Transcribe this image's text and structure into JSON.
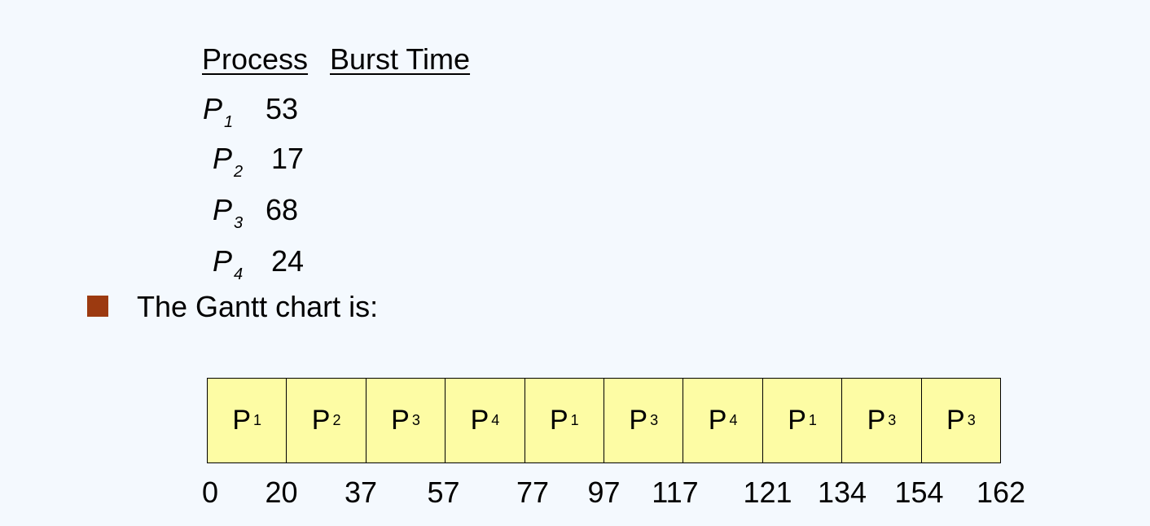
{
  "table": {
    "header_process": "Process",
    "header_burst": "Burst Time",
    "rows": [
      {
        "name": "P",
        "sub": "1",
        "burst": "53"
      },
      {
        "name": "P",
        "sub": "2",
        "burst": "17"
      },
      {
        "name": "P",
        "sub": "3",
        "burst": "68"
      },
      {
        "name": "P",
        "sub": "4",
        "burst": "24"
      }
    ]
  },
  "bullet": {
    "text": "The Gantt chart is:",
    "color": "#9c3a10"
  },
  "gantt": {
    "fill_color": "#fdfca4",
    "cells": [
      {
        "name": "P",
        "sub": "1"
      },
      {
        "name": "P",
        "sub": "2"
      },
      {
        "name": "P",
        "sub": "3"
      },
      {
        "name": "P",
        "sub": "4"
      },
      {
        "name": "P",
        "sub": "1"
      },
      {
        "name": "P",
        "sub": "3"
      },
      {
        "name": "P",
        "sub": "4"
      },
      {
        "name": "P",
        "sub": "1"
      },
      {
        "name": "P",
        "sub": "3"
      },
      {
        "name": "P",
        "sub": "3"
      }
    ],
    "ticks": [
      "0",
      "20",
      "37",
      "57",
      "77",
      "97",
      "117",
      "121",
      "134",
      "154",
      "162"
    ]
  }
}
